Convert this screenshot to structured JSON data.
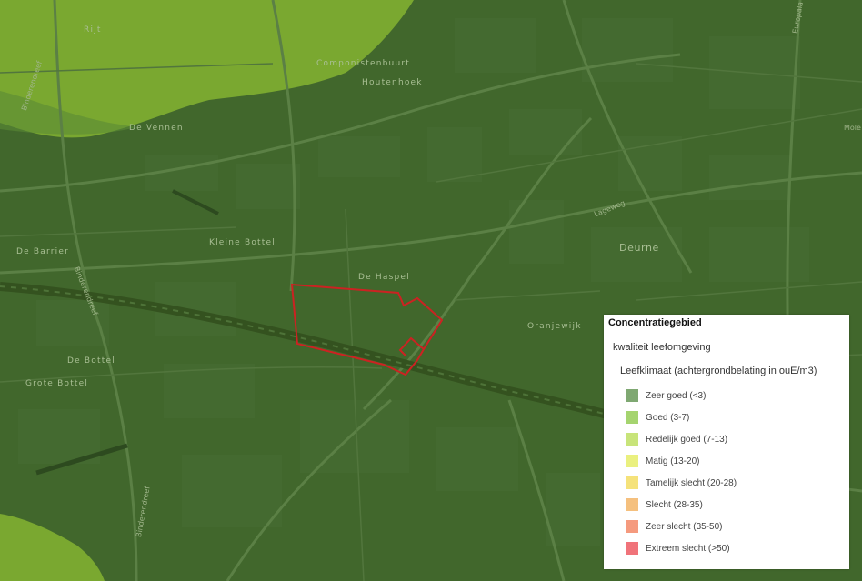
{
  "map": {
    "places": {
      "rijt": "Rijt",
      "componistenbuurt": "Componistenbuurt",
      "houtenhoek": "Houtenhoek",
      "de_vennen": "De Vennen",
      "kleine_bottel": "Kleine Bottel",
      "de_barrier": "De Barrier",
      "de_haspel": "De Haspel",
      "deurne": "Deurne",
      "oranjewijk": "Oranjewijk",
      "de_bottel": "De Bottel",
      "grote_bottel": "Grote Bottel"
    },
    "streets": {
      "binderendreef_1": "Binderendreef",
      "binderendreef_2": "Binderendreef",
      "binderendreef_3": "Binderendreef",
      "lageweg": "Lageweg",
      "europalaan": "Europala",
      "mole": "Mole"
    },
    "colors": {
      "base": "#3c5f2a",
      "zone_good": "#4f7d34",
      "zone_redelijk": "#8fbf3a",
      "zone_redelijk_light": "#a6c845",
      "road": "#557a42",
      "block": "#486e35",
      "rail": "#2d4a1f",
      "boundary": "#cc2222"
    }
  },
  "legend": {
    "title": "Concentratiegebied",
    "layer": "kwaliteit leefomgeving",
    "sublayer": "Leefklimaat (achtergrondbelating in ouE/m3)",
    "items": [
      {
        "label": "Zeer goed (<3)",
        "color": "#7fa872"
      },
      {
        "label": "Goed (3-7)",
        "color": "#a5d46f"
      },
      {
        "label": "Redelijk goed (7-13)",
        "color": "#c8e47a"
      },
      {
        "label": "Matig (13-20)",
        "color": "#eaf07f"
      },
      {
        "label": "Tamelijk slecht (20-28)",
        "color": "#f5e27a"
      },
      {
        "label": "Slecht (28-35)",
        "color": "#f5c07e"
      },
      {
        "label": "Zeer slecht (35-50)",
        "color": "#f59a7e"
      },
      {
        "label": "Extreem slecht (>50)",
        "color": "#f0737a"
      }
    ]
  }
}
